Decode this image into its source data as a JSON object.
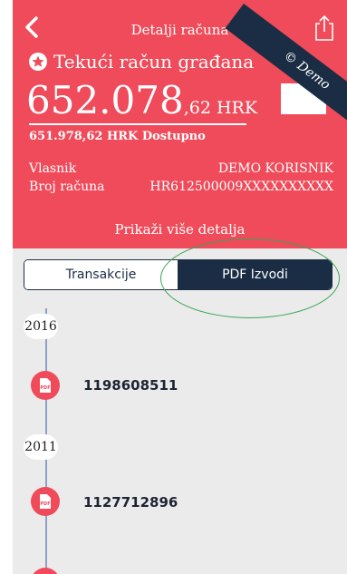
{
  "header": {
    "title": "Detalji računa",
    "account_name": "Tekući račun građana",
    "balance_main": "652.078",
    "balance_decimal": ",62 HRK",
    "available": "651.978,62 HRK Dostupno",
    "owner_label": "Vlasnik",
    "owner_value": "DEMO KORISNIK",
    "number_label": "Broj računa",
    "number_value": "HR612500009XXXXXXXXXX",
    "more_details": "Prikaži više detalja",
    "ribbon": "Demo",
    "accent_color": "#ef4b5a",
    "navy_color": "#1a2d44"
  },
  "tabs": {
    "transactions": "Transakcije",
    "pdf": "PDF Izvodi",
    "active": "pdf"
  },
  "timeline": {
    "years": [
      "2016",
      "2011"
    ],
    "statements": [
      "1198608511",
      "1127712896"
    ]
  }
}
